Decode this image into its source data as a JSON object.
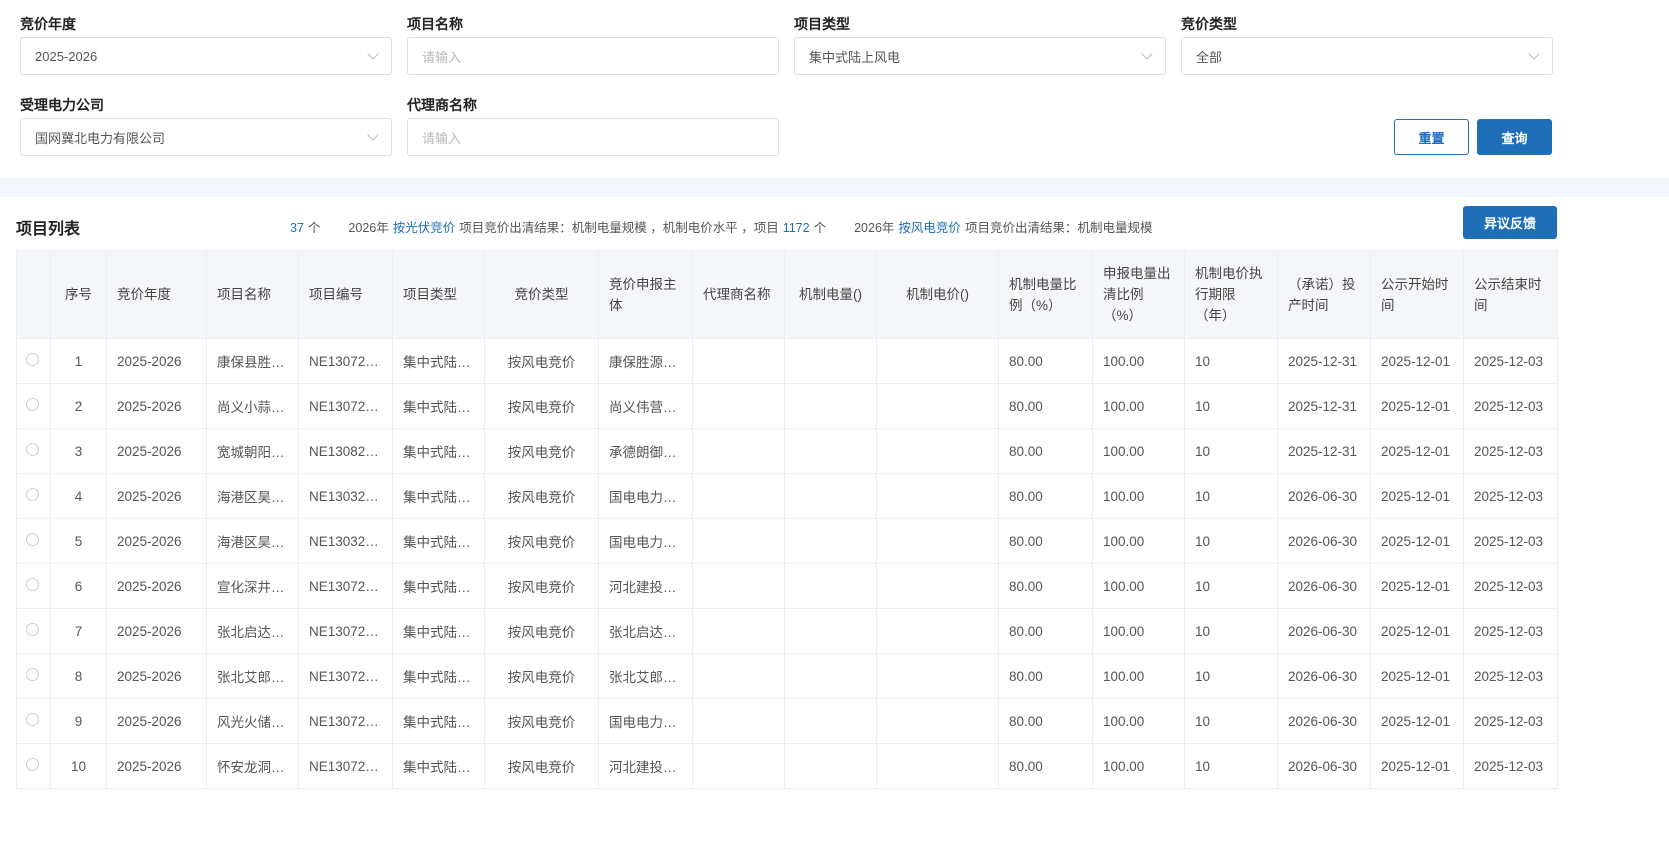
{
  "filters": {
    "bid_year": {
      "label": "竞价年度",
      "value": "2025-2026"
    },
    "project_name": {
      "label": "项目名称",
      "placeholder": "请输入"
    },
    "project_type": {
      "label": "项目类型",
      "value": "集中式陆上风电"
    },
    "bid_type": {
      "label": "竞价类型",
      "value": "全部"
    },
    "power_company": {
      "label": "受理电力公司",
      "value": "国网冀北电力有限公司"
    },
    "agent_name": {
      "label": "代理商名称",
      "placeholder": "请输入"
    },
    "reset": "重置",
    "query": "查询"
  },
  "list": {
    "title": "项目列表",
    "objection_button": "异议反馈",
    "marquee": [
      {
        "text": "37",
        "blue": true
      },
      {
        "text": "个"
      },
      {
        "text": "2026年"
      },
      {
        "text": "按光伏竞价",
        "blue": true
      },
      {
        "text": "项目竞价出清结果：机制电量规模 ，机制电价水平 ，项目"
      },
      {
        "text": "1172",
        "blue": true
      },
      {
        "text": "个"
      },
      {
        "text": "2026年"
      },
      {
        "text": "按风电竞价",
        "blue": true
      },
      {
        "text": "项目竞价出清结果：机制电量规模"
      }
    ],
    "columns": [
      "",
      "序号",
      "竞价年度",
      "项目名称",
      "项目编号",
      "项目类型",
      "竞价类型",
      "竞价申报主体",
      "代理商名称",
      "机制电量()",
      "机制电价()",
      "机制电量比例（%）",
      "申报电量出清比例（%）",
      "机制电价执行期限（年）",
      "（承诺）投产时间",
      "公示开始时间",
      "公示结束时间"
    ],
    "rows": [
      [
        "1",
        "2025-2026",
        "康保县胜…",
        "NE13072…",
        "集中式陆…",
        "按风电竞价",
        "康保胜源…",
        "",
        "",
        "",
        "80.00",
        "100.00",
        "10",
        "2025-12-31",
        "2025-12-01",
        "2025-12-03"
      ],
      [
        "2",
        "2025-2026",
        "尚义小蒜…",
        "NE13072…",
        "集中式陆…",
        "按风电竞价",
        "尚义伟营…",
        "",
        "",
        "",
        "80.00",
        "100.00",
        "10",
        "2025-12-31",
        "2025-12-01",
        "2025-12-03"
      ],
      [
        "3",
        "2025-2026",
        "宽城朝阳…",
        "NE13082…",
        "集中式陆…",
        "按风电竞价",
        "承德朗御…",
        "",
        "",
        "",
        "80.00",
        "100.00",
        "10",
        "2025-12-31",
        "2025-12-01",
        "2025-12-03"
      ],
      [
        "4",
        "2025-2026",
        "海港区昊…",
        "NE13032…",
        "集中式陆…",
        "按风电竞价",
        "国电电力…",
        "",
        "",
        "",
        "80.00",
        "100.00",
        "10",
        "2026-06-30",
        "2025-12-01",
        "2025-12-03"
      ],
      [
        "5",
        "2025-2026",
        "海港区昊…",
        "NE13032…",
        "集中式陆…",
        "按风电竞价",
        "国电电力…",
        "",
        "",
        "",
        "80.00",
        "100.00",
        "10",
        "2026-06-30",
        "2025-12-01",
        "2025-12-03"
      ],
      [
        "6",
        "2025-2026",
        "宣化深井…",
        "NE13072…",
        "集中式陆…",
        "按风电竞价",
        "河北建投…",
        "",
        "",
        "",
        "80.00",
        "100.00",
        "10",
        "2026-06-30",
        "2025-12-01",
        "2025-12-03"
      ],
      [
        "7",
        "2025-2026",
        "张北启达…",
        "NE13072…",
        "集中式陆…",
        "按风电竞价",
        "张北启达…",
        "",
        "",
        "",
        "80.00",
        "100.00",
        "10",
        "2026-06-30",
        "2025-12-01",
        "2025-12-03"
      ],
      [
        "8",
        "2025-2026",
        "张北艾郎…",
        "NE13072…",
        "集中式陆…",
        "按风电竞价",
        "张北艾郎…",
        "",
        "",
        "",
        "80.00",
        "100.00",
        "10",
        "2026-06-30",
        "2025-12-01",
        "2025-12-03"
      ],
      [
        "9",
        "2025-2026",
        "风光火储…",
        "NE13072…",
        "集中式陆…",
        "按风电竞价",
        "国电电力…",
        "",
        "",
        "",
        "80.00",
        "100.00",
        "10",
        "2026-06-30",
        "2025-12-01",
        "2025-12-03"
      ],
      [
        "10",
        "2025-2026",
        "怀安龙洞…",
        "NE13072…",
        "集中式陆…",
        "按风电竞价",
        "河北建投…",
        "",
        "",
        "",
        "80.00",
        "100.00",
        "10",
        "2026-06-30",
        "2025-12-01",
        "2025-12-03"
      ]
    ]
  },
  "colors": {
    "primary": "#1e6fb8",
    "header_bg": "#f5f6f9"
  }
}
